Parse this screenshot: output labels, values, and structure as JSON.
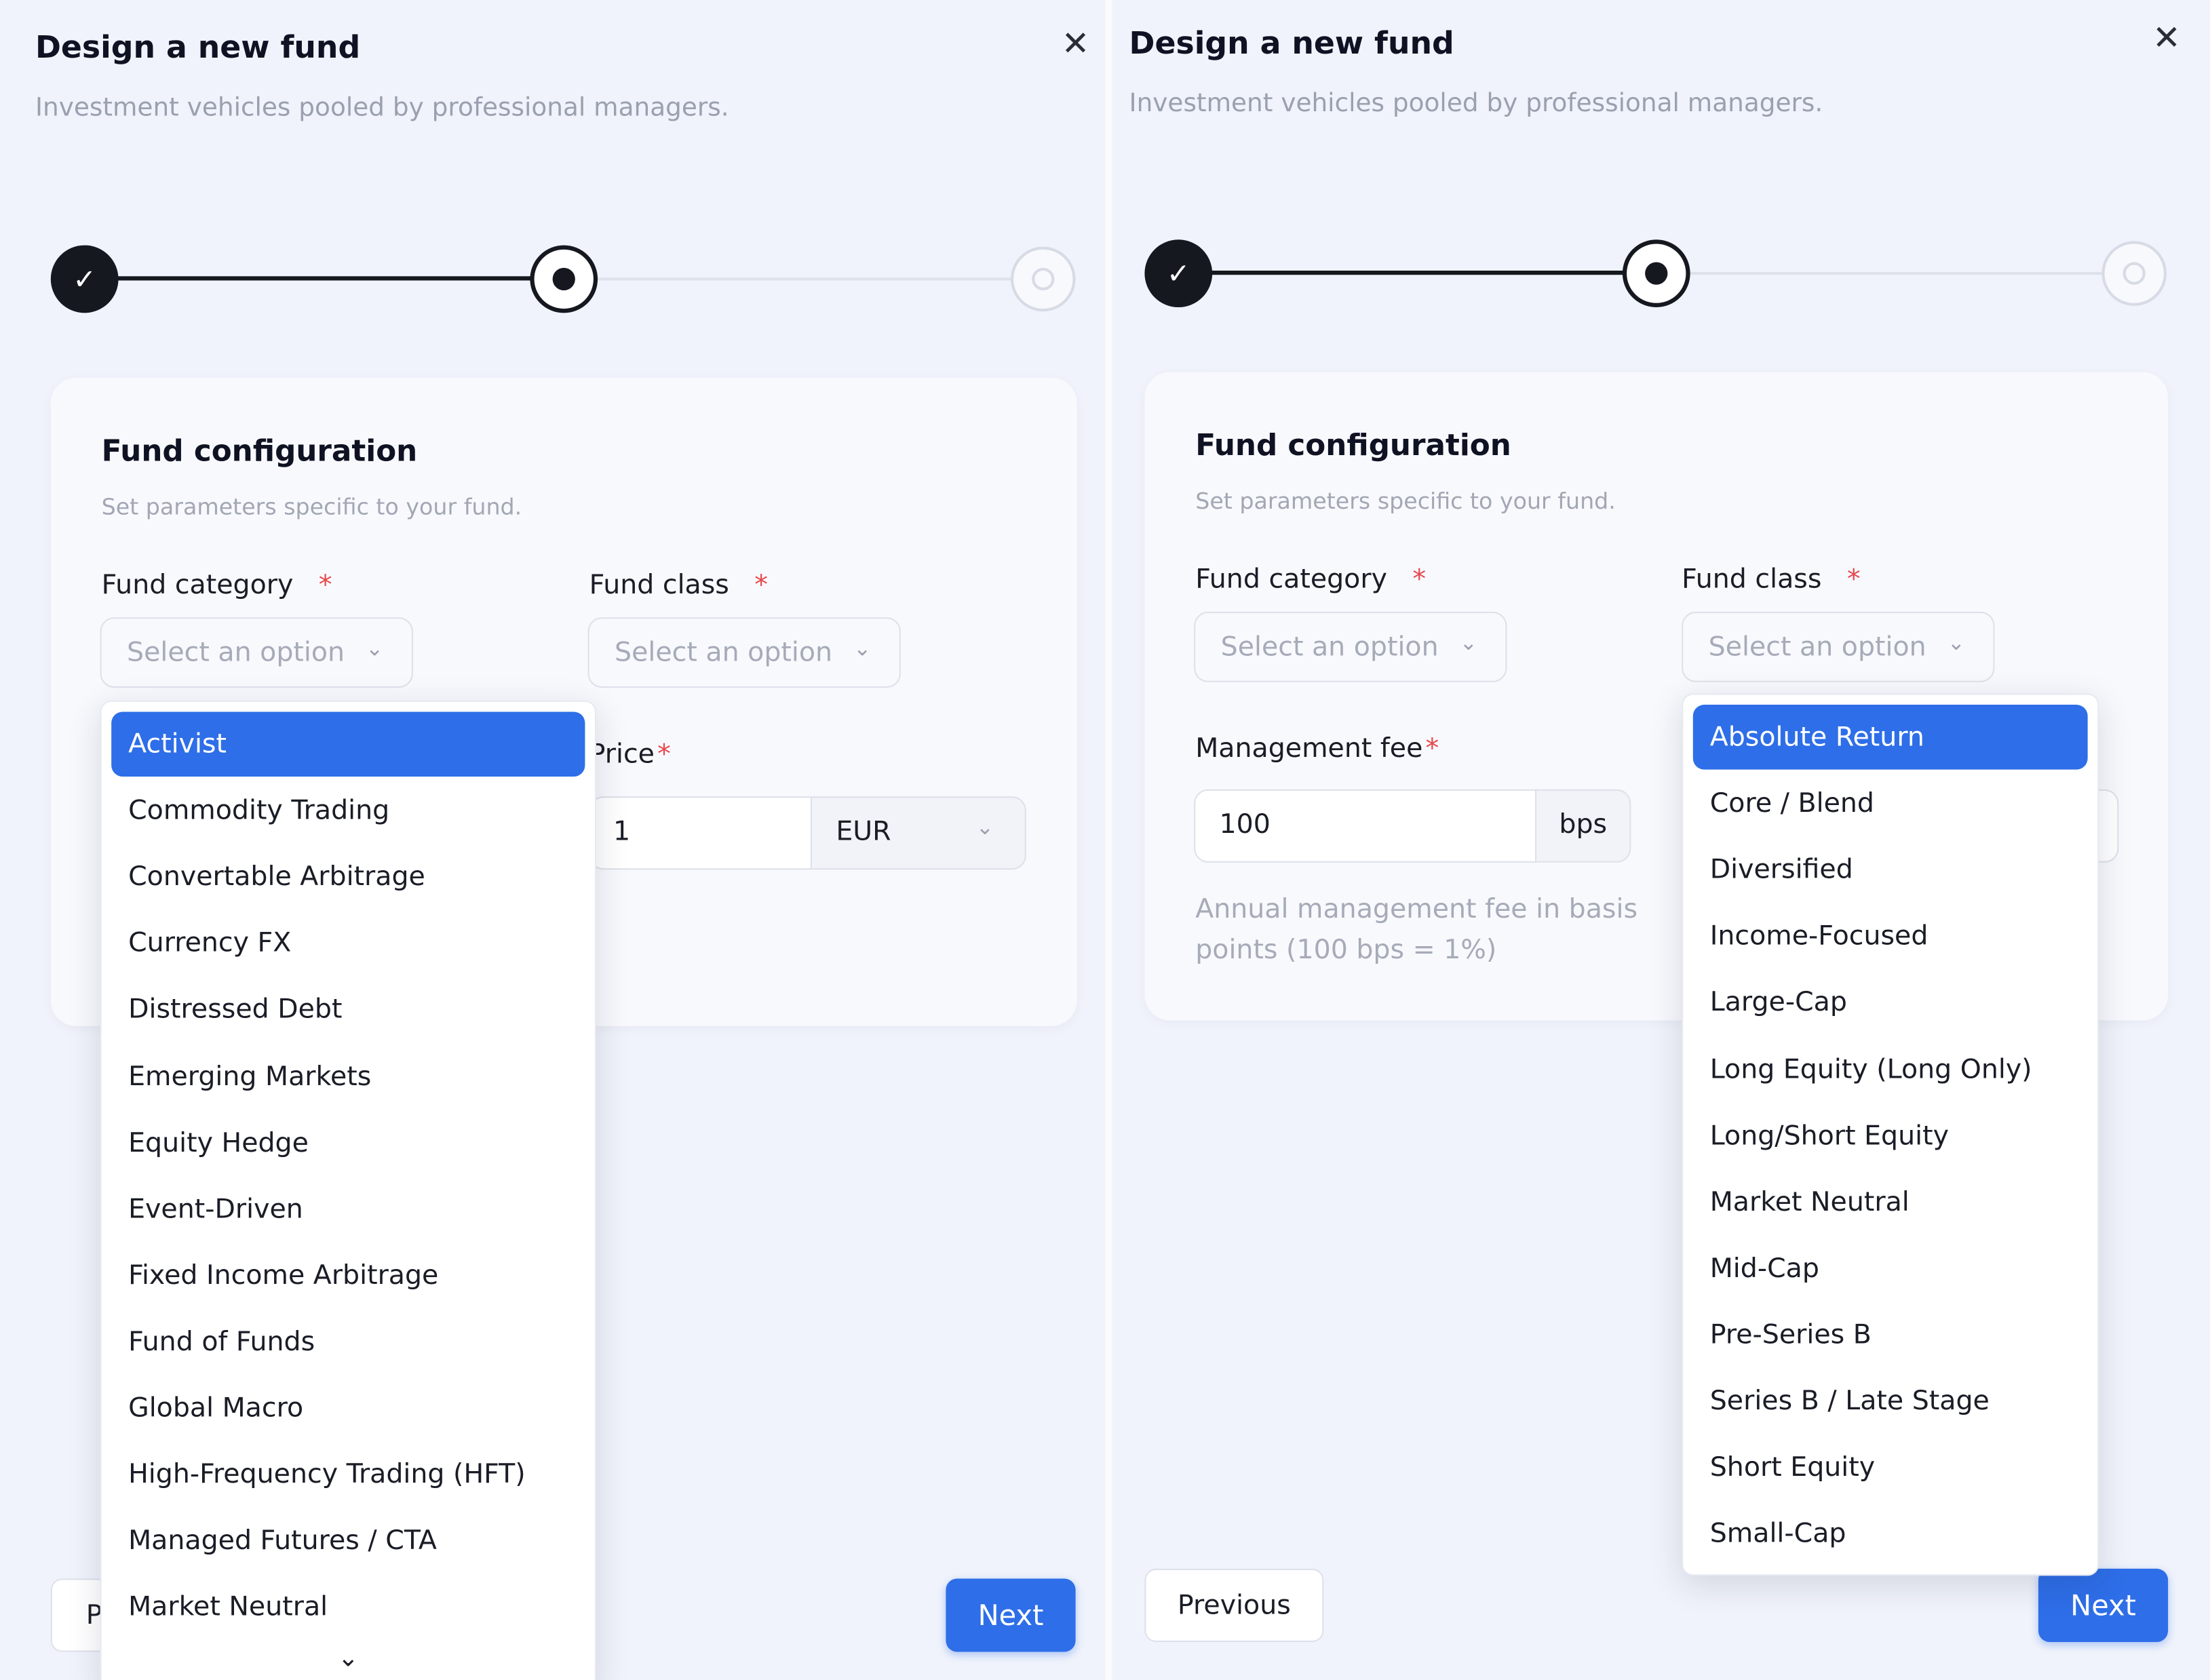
{
  "modal": {
    "title": "Design a new fund",
    "subtitle": "Investment vehicles pooled by professional managers.",
    "close_glyph": "✕",
    "check_glyph": "✓"
  },
  "card": {
    "title": "Fund configuration",
    "subtitle": "Set parameters specific to your fund."
  },
  "fields": {
    "fund_category_label": "Fund category",
    "fund_class_label": "Fund class",
    "required_mark": "*",
    "placeholder": "Select an option",
    "chevron": "⌄",
    "price_label": "Price",
    "price_value": "1",
    "currency_value": "EUR",
    "management_fee_label": "Management fee",
    "management_fee_value": "100",
    "management_fee_unit": "bps",
    "management_fee_hint_line1": "Annual management fee in basis",
    "management_fee_hint_line2": "points (100 bps = 1%)"
  },
  "category_options": [
    "Activist",
    "Commodity Trading",
    "Convertable Arbitrage",
    "Currency FX",
    "Distressed Debt",
    "Emerging Markets",
    "Equity Hedge",
    "Event-Driven",
    "Fixed Income Arbitrage",
    "Fund of Funds",
    "Global Macro",
    "High-Frequency Trading (HFT)",
    "Managed Futures / CTA",
    "Market Neutral"
  ],
  "class_options": [
    "Absolute Return",
    "Core / Blend",
    "Diversified",
    "Income-Focused",
    "Large-Cap",
    "Long Equity (Long Only)",
    "Long/Short Equity",
    "Market Neutral",
    "Mid-Cap",
    "Pre-Series B",
    "Series B / Late Stage",
    "Short Equity",
    "Small-Cap"
  ],
  "footer": {
    "previous_label": "Previous",
    "previous_partial": "P",
    "next_label": "Next",
    "scroll_down_glyph": "⌄"
  },
  "colors": {
    "accent": "#2e6ee8",
    "step_dark": "#161820",
    "required": "#e5484d"
  }
}
